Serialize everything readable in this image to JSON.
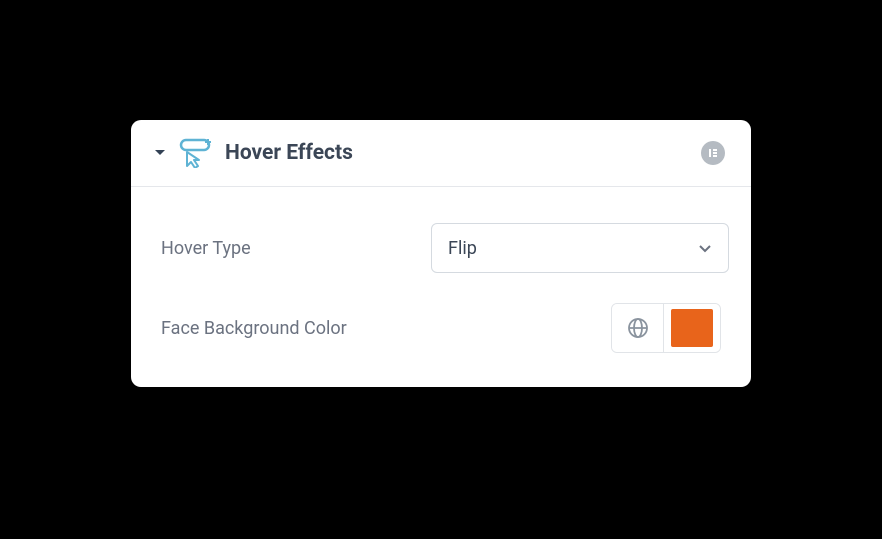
{
  "panel": {
    "title": "Hover Effects"
  },
  "fields": {
    "hoverType": {
      "label": "Hover Type",
      "value": "Flip"
    },
    "faceBg": {
      "label": "Face Background Color",
      "color": "#e8641b"
    }
  }
}
